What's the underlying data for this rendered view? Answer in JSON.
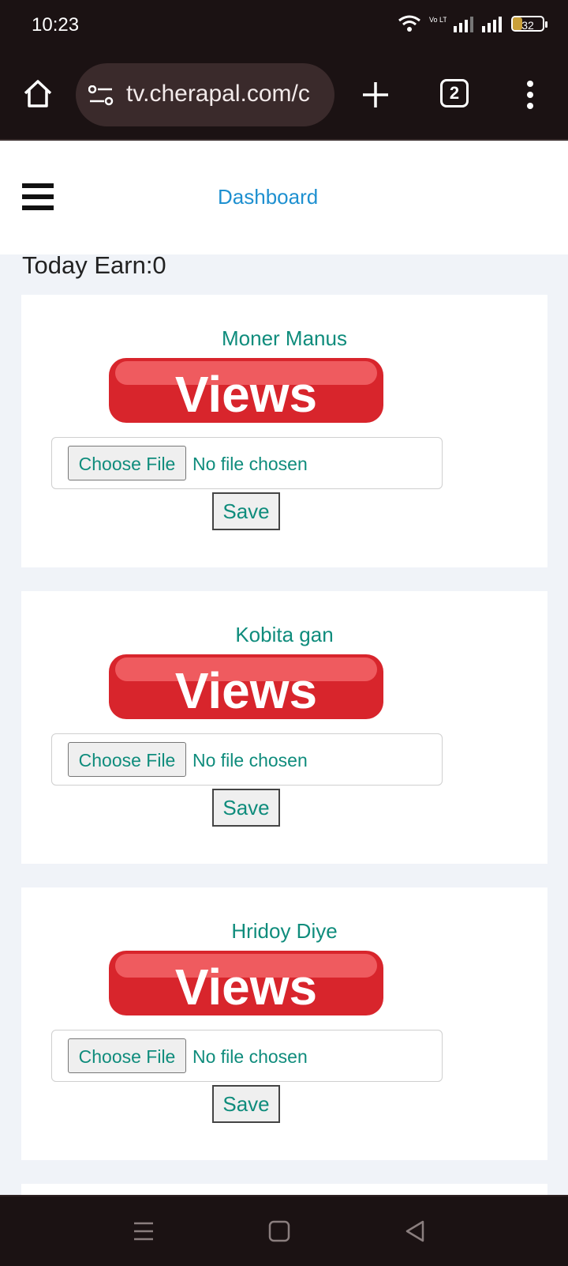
{
  "status_bar": {
    "time": "10:23",
    "network_label": "Vo LTE",
    "battery": "32"
  },
  "browser": {
    "url": "tv.cherapal.com/c",
    "tab_count": "2"
  },
  "nav": {
    "dashboard_link": "Dashboard"
  },
  "earnings": {
    "label": "Today Earn:0"
  },
  "cards": [
    {
      "title": "Moner Manus",
      "image_text": "Views",
      "choose_label": "Choose File",
      "file_status": "No file chosen",
      "save_label": "Save"
    },
    {
      "title": "Kobita gan",
      "image_text": "Views",
      "choose_label": "Choose File",
      "file_status": "No file chosen",
      "save_label": "Save"
    },
    {
      "title": "Hridoy Diye",
      "image_text": "Views",
      "choose_label": "Choose File",
      "file_status": "No file chosen",
      "save_label": "Save"
    }
  ],
  "colors": {
    "accent": "#0f8c7c",
    "link": "#1e90d0",
    "views_red": "#d8252c"
  }
}
